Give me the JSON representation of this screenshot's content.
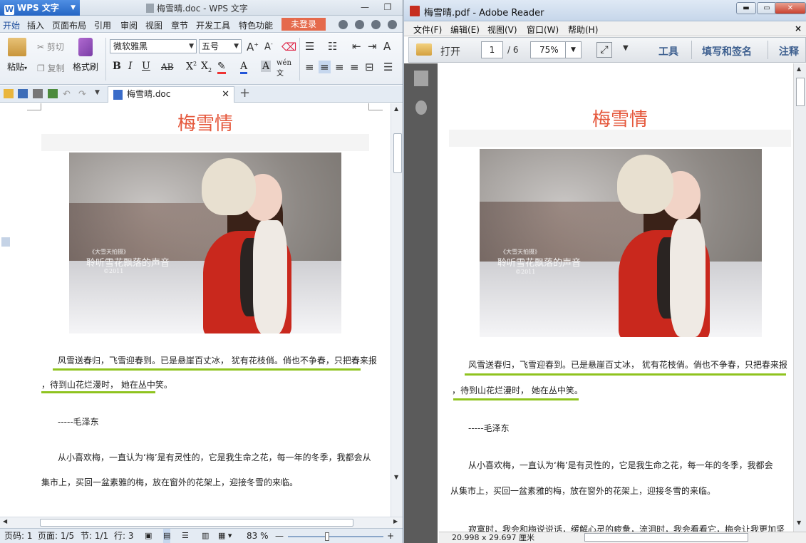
{
  "wps": {
    "app_button": "WPS 文字",
    "window_title": "梅雪晴.doc - WPS 文字",
    "menu": [
      "开始",
      "插入",
      "页面布局",
      "引用",
      "审阅",
      "视图",
      "章节",
      "开发工具",
      "特色功能"
    ],
    "login_label": "未登录",
    "ribbon": {
      "paste": "粘贴",
      "cut": "剪切",
      "copy": "复制",
      "format_painter": "格式刷",
      "font_name": "微软雅黑",
      "font_size": "五号"
    },
    "tab_label": "梅雪晴.doc",
    "status": {
      "page": "页码: 1",
      "pages": "页面: 1/5",
      "section": "节: 1/1",
      "row": "行: 3",
      "zoom": "83 %"
    }
  },
  "pdf": {
    "window_title": "梅雪晴.pdf - Adobe Reader",
    "menu": [
      "文件(F)",
      "编辑(E)",
      "视图(V)",
      "窗口(W)",
      "帮助(H)"
    ],
    "close_x": "×",
    "toolbar": {
      "open": "打开",
      "page_current": "1",
      "page_total": "/ 6",
      "zoom": "75%",
      "tools": "工具",
      "fill_sign": "填写和签名",
      "comment": "注释"
    },
    "status_size": "20.998 x 29.697 厘米"
  },
  "doc": {
    "title": "梅雪情",
    "watermark_small": "《大雪天拍摄》",
    "watermark_big": "聆听雪花飘落的声音",
    "watermark_year": "©2011",
    "p1_line1": "风雪送春归，飞雪迎春到。已是悬崖百丈冰， 犹有花枝俏。俏也不争春，只把春来报",
    "p1_line2": "，待到山花烂漫时， 她在丛中笑。",
    "author": "-----毛泽东",
    "p2_line1": "从小喜欢梅，一直认为‘梅’是有灵性的，它是我生命之花，每一年的冬季，我都会从",
    "p2_line1_pdf": "从小喜欢梅，一直认为‘梅’是有灵性的，它是我生命之花，每一年的冬季，我都会",
    "p2_line2": "集市上，买回一盆素雅的梅，放在窗外的花架上，迎接冬雪的来临。",
    "p2_line2_pdf": "从集市上，买回一盆素雅的梅，放在窗外的花架上，迎接冬雪的来临。",
    "p3_line1_pdf": "寂寞时，我会和梅说说话，缓解心灵的疲惫，流泪时，我会看看它，梅会让我更加坚"
  },
  "colors": {
    "title_red": "#e5583c",
    "underline_green": "#8fc31f",
    "login_red": "#e56a4c"
  }
}
